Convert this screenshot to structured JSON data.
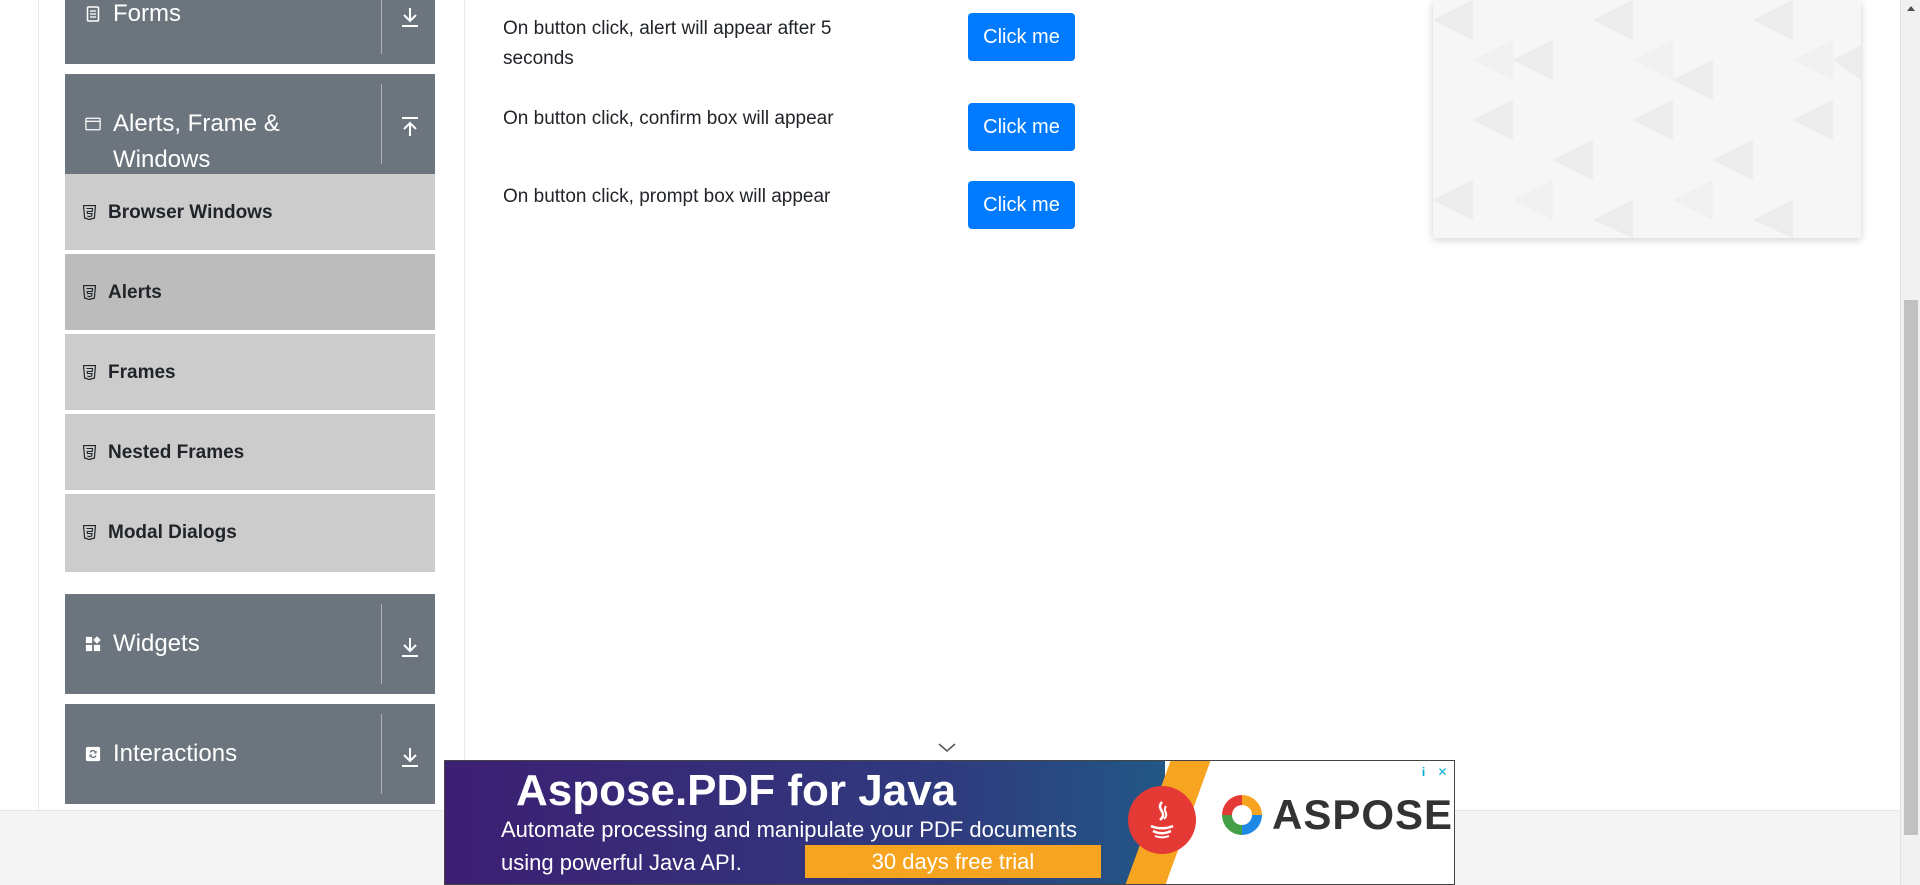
{
  "sidebar": {
    "groups": [
      {
        "label": "Forms",
        "icon": "document-icon",
        "toggle": "download-arrow-icon"
      },
      {
        "label_line1": "Alerts, Frame &",
        "label_line2": "Windows",
        "icon": "window-icon",
        "toggle": "upload-arrow-icon"
      },
      {
        "label": "Widgets",
        "icon": "widgets-icon",
        "toggle": "download-arrow-icon"
      },
      {
        "label": "Interactions",
        "icon": "interactions-icon",
        "toggle": "download-arrow-icon"
      }
    ],
    "subitems": [
      {
        "label": "Browser Windows",
        "active": false
      },
      {
        "label": "Alerts",
        "active": true
      },
      {
        "label": "Frames",
        "active": false
      },
      {
        "label": "Nested Frames",
        "active": false
      },
      {
        "label": "Modal Dialogs",
        "active": false
      }
    ]
  },
  "main": {
    "rows": [
      {
        "text_line1": "On button click, alert will appear after 5",
        "text_line2": "seconds",
        "button": "Click me"
      },
      {
        "text": "On button click, confirm box will appear",
        "button": "Click me"
      },
      {
        "text": "On button click, prompt box will appear",
        "button": "Click me"
      }
    ]
  },
  "banner_ad": {
    "title": "Aspose.PDF for Java",
    "text_line1": "Automate processing and manipulate your PDF documents",
    "text_line2": "using powerful Java API.",
    "cta": "30 days free trial",
    "brand": "ASPOSE",
    "info_glyph": "i",
    "close_glyph": "✕"
  },
  "colors": {
    "sidebar_group_bg": "#6c757d",
    "sidebar_item_bg": "#cccccc",
    "sidebar_item_active_bg": "#bcbcbc",
    "button_primary": "#007bff",
    "banner_accent": "#f7a521"
  }
}
